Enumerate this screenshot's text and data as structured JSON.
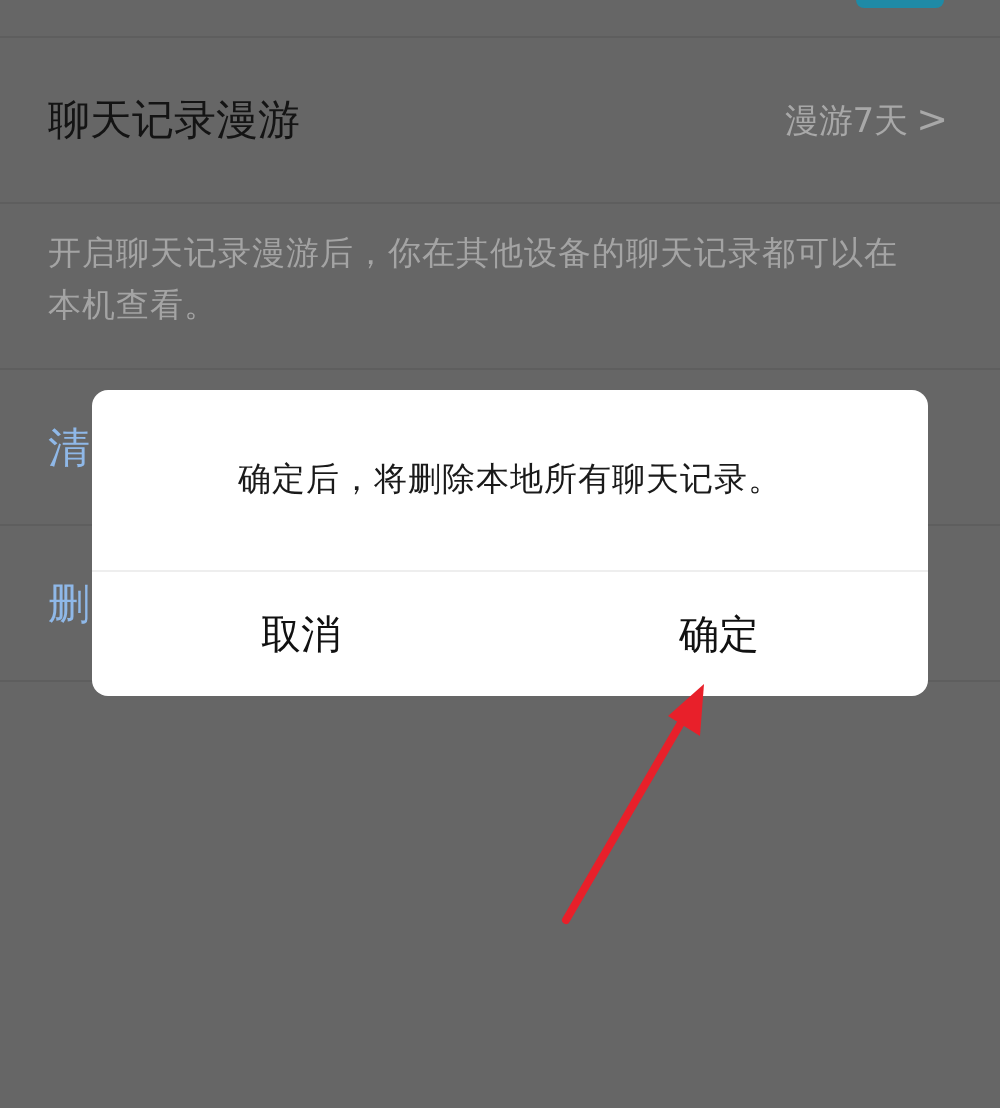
{
  "top_toggle": {
    "on": true
  },
  "settings": [
    {
      "kind": "nav",
      "title": "聊天记录漫游",
      "value": "漫游7天",
      "chevron": ">"
    },
    {
      "kind": "note",
      "title": "开启聊天记录漫游后，你在其他设备的聊天记录都可以在本机查看。"
    },
    {
      "kind": "action",
      "title": "清"
    },
    {
      "kind": "action",
      "title": "删"
    }
  ],
  "dialog": {
    "message": "确定后，将删除本地所有聊天记录。",
    "buttons": [
      "取消",
      "确定"
    ]
  },
  "annotation": {
    "kind": "arrow"
  }
}
